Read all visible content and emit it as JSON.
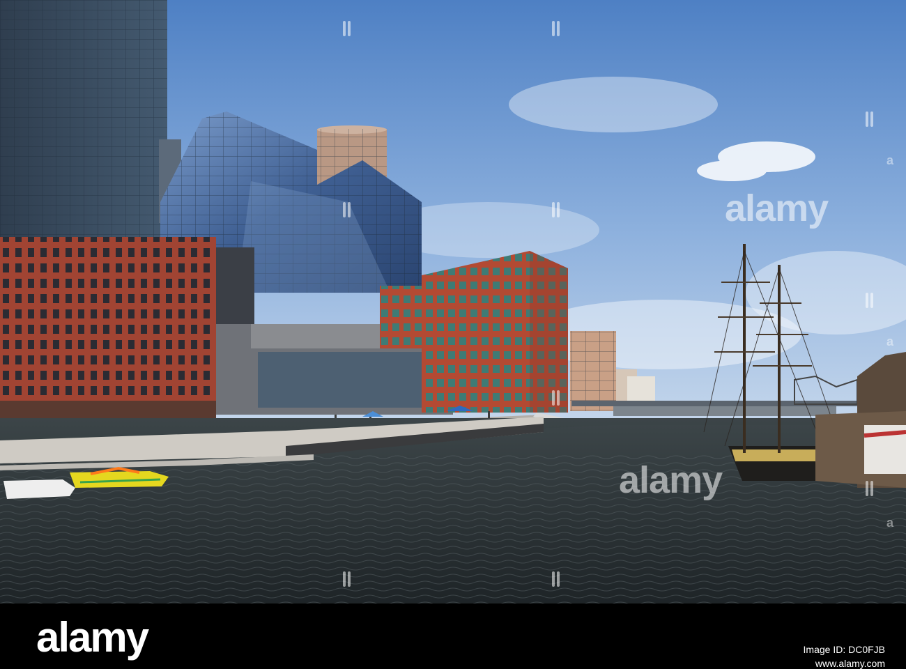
{
  "watermark": {
    "text": "alamy",
    "sub": "a"
  },
  "footer": {
    "brand": "alamy",
    "image_id": "Image ID: DC0FJB",
    "url": "www.alamy.com"
  },
  "colors": {
    "sky_top": "#4f82c6",
    "sky_bottom": "#b9d0ea",
    "water": "#2b3338",
    "brick": "#9b3d2e",
    "glass": "#4d6f9c",
    "boat_yellow": "#e7d42a"
  }
}
